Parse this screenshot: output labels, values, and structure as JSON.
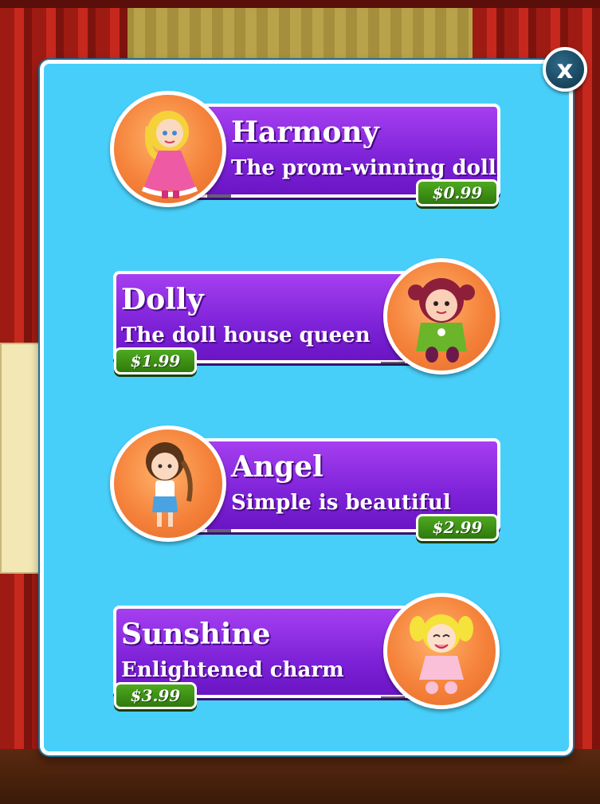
{
  "store": {
    "close_label": "x",
    "items": [
      {
        "name": "Harmony",
        "tagline": "The prom-winning doll",
        "price": "$0.99",
        "portrait_icon": "harmony-doll-icon"
      },
      {
        "name": "Dolly",
        "tagline": "The doll house queen",
        "price": "$1.99",
        "portrait_icon": "dolly-doll-icon"
      },
      {
        "name": "Angel",
        "tagline": "Simple is beautiful",
        "price": "$2.99",
        "portrait_icon": "angel-doll-icon"
      },
      {
        "name": "Sunshine",
        "tagline": "Enlightened charm",
        "price": "$3.99",
        "portrait_icon": "sunshine-doll-icon"
      }
    ]
  },
  "colors": {
    "modal_bg": "#48cff9",
    "banner": "#8a2be2",
    "price_tag": "#3d8f15",
    "portrait": "#f5823a",
    "close_button": "#1b4a63"
  }
}
